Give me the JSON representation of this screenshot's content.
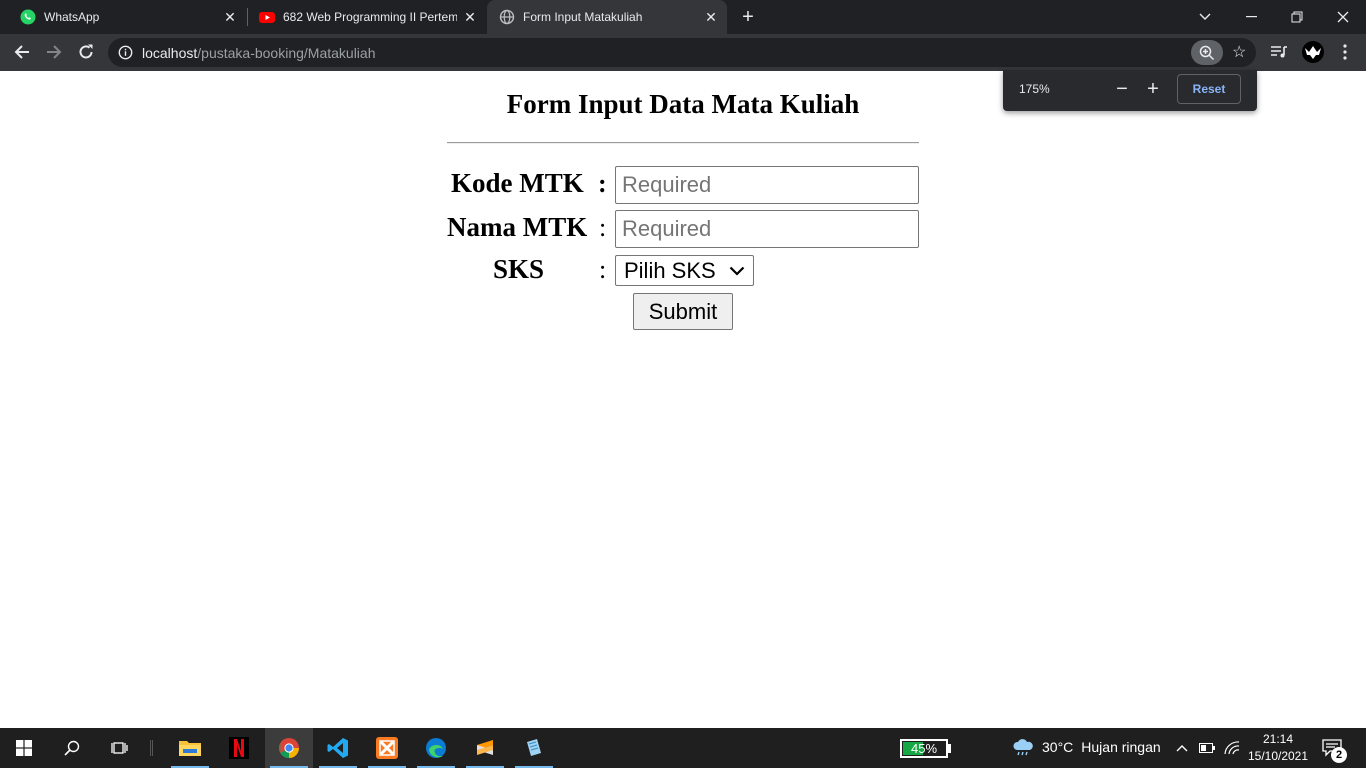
{
  "browser": {
    "tabs": [
      {
        "title": "WhatsApp",
        "icon": "whatsapp-icon",
        "active": false
      },
      {
        "title": "682 Web Programming II Pertemu",
        "icon": "youtube-icon",
        "active": false
      },
      {
        "title": "Form Input Matakuliah",
        "icon": "globe-icon",
        "active": true
      }
    ],
    "url_host": "localhost",
    "url_path": "/pustaka-booking/Matakuliah",
    "zoom": {
      "level": "175%",
      "reset_label": "Reset"
    }
  },
  "page": {
    "title": "Form Input Data Mata Kuliah",
    "fields": {
      "kode": {
        "label": "Kode MTK",
        "colon": ":",
        "placeholder": "Required",
        "value": ""
      },
      "nama": {
        "label": "Nama MTK",
        "colon": ":",
        "placeholder": "Required",
        "value": ""
      },
      "sks": {
        "label": "SKS",
        "colon": ":",
        "selected": "Pilih SKS"
      }
    },
    "submit_label": "Submit"
  },
  "taskbar": {
    "apps": [
      "windows-start",
      "search",
      "task-view",
      "file-explorer",
      "netflix",
      "chrome",
      "vscode",
      "xampp",
      "edge",
      "sublime-text",
      "notepad"
    ],
    "battery_percent": "45%",
    "battery_level": 0.45,
    "weather": {
      "temp": "30°C",
      "desc": "Hujan ringan"
    },
    "time": "21:14",
    "date": "15/10/2021",
    "notification_count": "2"
  },
  "colors": {
    "tab_strip": "#202124",
    "toolbar": "#35363a",
    "accent_blue": "#8ab4f8",
    "taskbar": "#1f1f1f",
    "battery_green": "#18a745"
  }
}
